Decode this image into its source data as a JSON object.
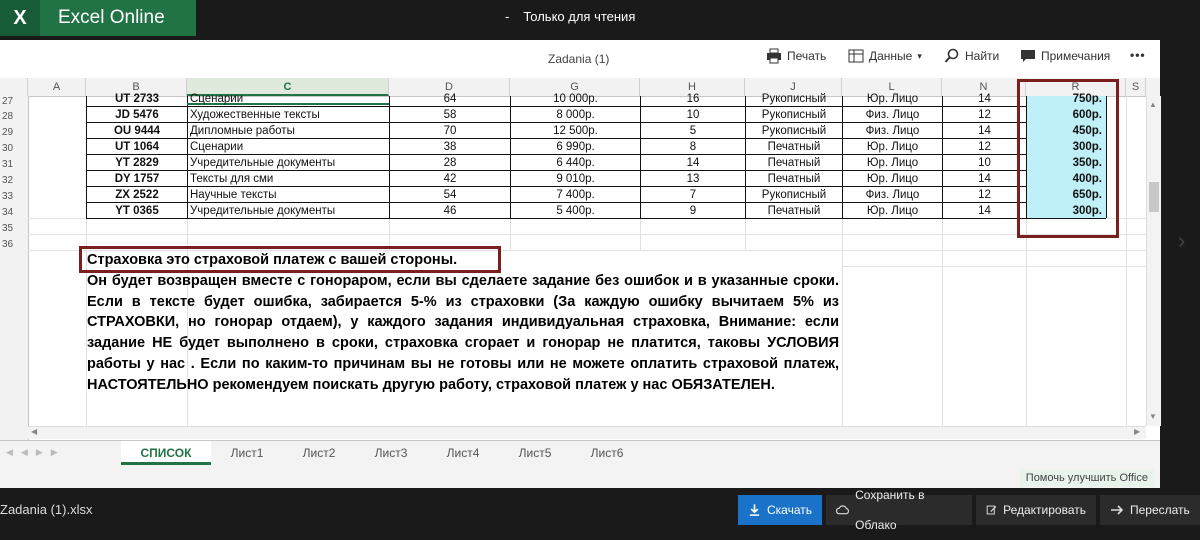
{
  "app": {
    "name": "Excel Online",
    "logo_letter": "X"
  },
  "window": {
    "separator": "-",
    "mode": "Только для чтения"
  },
  "ribbon": {
    "doc_title": "Zadania (1)",
    "print": "Печать",
    "data": "Данные",
    "find": "Найти",
    "comments": "Примечания",
    "more": "•••"
  },
  "columns": [
    "A",
    "B",
    "C",
    "D",
    "G",
    "H",
    "J",
    "L",
    "N",
    "R",
    "S"
  ],
  "rows": [
    {
      "num": "27",
      "b": "UT 2733",
      "c": "Сценарии",
      "d": "64",
      "g": "10 000р.",
      "h": "16",
      "j": "Рукописный",
      "l": "Юр. Лицо",
      "n": "14",
      "r": "750р."
    },
    {
      "num": "28",
      "b": "JD 5476",
      "c": "Художественные тексты",
      "d": "58",
      "g": "8 000р.",
      "h": "10",
      "j": "Рукописный",
      "l": "Физ. Лицо",
      "n": "12",
      "r": "600р."
    },
    {
      "num": "29",
      "b": "OU 9444",
      "c": "Дипломные работы",
      "d": "70",
      "g": "12 500р.",
      "h": "5",
      "j": "Рукописный",
      "l": "Физ. Лицо",
      "n": "14",
      "r": "450р."
    },
    {
      "num": "30",
      "b": "UT 1064",
      "c": "Сценарии",
      "d": "38",
      "g": "6 990р.",
      "h": "8",
      "j": "Печатный",
      "l": "Юр. Лицо",
      "n": "12",
      "r": "300р."
    },
    {
      "num": "31",
      "b": "YT 2829",
      "c": "Учредительные документы",
      "d": "28",
      "g": "6 440р.",
      "h": "14",
      "j": "Печатный",
      "l": "Юр. Лицо",
      "n": "10",
      "r": "350р."
    },
    {
      "num": "32",
      "b": "DY 1757",
      "c": "Тексты для сми",
      "d": "42",
      "g": "9 010р.",
      "h": "13",
      "j": "Печатный",
      "l": "Юр. Лицо",
      "n": "14",
      "r": "400р."
    },
    {
      "num": "33",
      "b": "ZX 2522",
      "c": "Научные тексты",
      "d": "54",
      "g": "7 400р.",
      "h": "7",
      "j": "Рукописный",
      "l": "Физ. Лицо",
      "n": "12",
      "r": "650р."
    },
    {
      "num": "34",
      "b": "YT 0365",
      "c": "Учредительные документы",
      "d": "46",
      "g": "5 400р.",
      "h": "9",
      "j": "Печатный",
      "l": "Юр. Лицо",
      "n": "14",
      "r": "300р."
    }
  ],
  "empty_rows": [
    "35",
    "36"
  ],
  "note": {
    "headline": "Страховка это страховой платеж с вашей стороны.",
    "body": "Он будет возвращен вместе с гонораром, если вы сделаете задание без ошибок и в указанные сроки. Если в тексте будет ошибка, забирается 5-% из страховки (За каждую ошибку вычитаем 5% из СТРАХОВКИ, но гонорар отдаем), у каждого задания индивидуальная страховка, Внимание: если задание НЕ будет выполнено в  сроки, страховка сгорает и гонорар не платится, таковы УСЛОВИЯ работы у нас . Если по каким-то причинам вы не готовы или не можете оплатить страховой платеж, НАСТОЯТЕЛЬНО рекомендуем поискать другую работу, страховой платеж у нас ОБЯЗАТЕЛЕН."
  },
  "sheets": [
    "СПИСОК",
    "Лист1",
    "Лист2",
    "Лист3",
    "Лист4",
    "Лист5",
    "Лист6"
  ],
  "status": {
    "improve": "Помочь улучшить Office"
  },
  "bottom": {
    "filename": "Zadania (1).xlsx",
    "download": "Скачать",
    "save_cloud": "Сохранить в Облако",
    "edit": "Редактировать",
    "forward": "Переслать"
  },
  "colors": {
    "brand": "#217346",
    "highlight": "#bff0f8",
    "redbox": "#7b1e1e",
    "download": "#1a73c9"
  }
}
